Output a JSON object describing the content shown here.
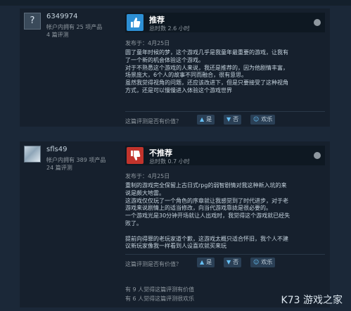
{
  "reviews": [
    {
      "user_name": "6349974",
      "products": "帐户内拥有 25 项产品",
      "review_count": "4 篇评测",
      "avatar_glyph": "?",
      "verdict": "推荐",
      "hours": "总时数 2.6 小时",
      "posted": "发布于：4月25日",
      "body": [
        "圆了童年时候的梦，这个游戏几乎是我童年最重要的游戏，让我有",
        "了一个新的机会体验这个游戏。",
        "对于不熟悉这个游戏的人来说，我还是推荐的，因为他剧情丰富，",
        "场景庞大，6个人的故事不同而融合，很有意思。",
        "虽然我觉得视角的问题，还应该改进下，但是只要接受了这种视角",
        "方式，还是可以慢慢进入体验这个游戏世界"
      ],
      "helpful_q": "这篇评测是否有价值？",
      "yes": "是",
      "no": "否",
      "funny": "欢乐"
    },
    {
      "user_name": "sfls49",
      "products": "帐户内拥有 389 项产品",
      "review_count": "24 篇评测",
      "verdict": "不推荐",
      "hours": "总时数 0.7 小时",
      "posted": "发布于：4月25日",
      "body": [
        "重制的游戏完全保留上古日式rpg的弱智剧情对我这种新入坑的来",
        "说是颇大地雷。",
        "这游戏仅仅玩了一个角色的序章就让我感觉到了时代进步，对于老",
        "游戏来说剧情上的适当修改，向当代游戏靠拢是很必要的。",
        "一个游戏光是30分钟开场就让人出戏时，我觉得这个游戏就已经失",
        "败了。",
        "",
        "提前向得罪的老玩家道个歉，这游戏太概只适合怀旧，我个人不建",
        "议新玩家像我一样看到人设喜欢就买来玩"
      ],
      "helpful_q": "这篇评测是否有价值？",
      "yes": "是",
      "no": "否",
      "funny": "欢乐",
      "footer": [
        "有 9 人觉得这篇评测有价值",
        "有 6 人觉得这篇评测很欢乐"
      ]
    }
  ],
  "watermark": "K73 游戏之家"
}
